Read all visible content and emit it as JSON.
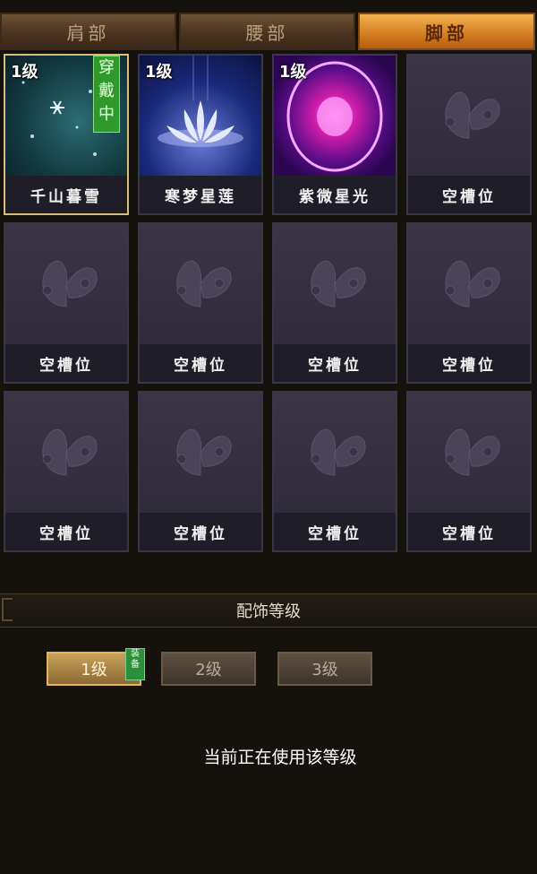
{
  "tabs": [
    "肩部",
    "腰部",
    "脚部"
  ],
  "active_tab": "脚部",
  "slots": [
    {
      "level": "1级",
      "name": "千山暮雪",
      "worn": "穿戴中"
    },
    {
      "level": "1级",
      "name": "寒梦星莲"
    },
    {
      "level": "1级",
      "name": "紫微星光"
    },
    {
      "name": "空槽位"
    },
    {
      "name": "空槽位"
    },
    {
      "name": "空槽位"
    },
    {
      "name": "空槽位"
    },
    {
      "name": "空槽位"
    },
    {
      "name": "空槽位"
    },
    {
      "name": "空槽位"
    },
    {
      "name": "空槽位"
    },
    {
      "name": "空槽位"
    }
  ],
  "section_title": "配饰等级",
  "levels": [
    {
      "label": "1级",
      "tag": "装备"
    },
    {
      "label": "2级"
    },
    {
      "label": "3级"
    }
  ],
  "status_text": "当前正在使用该等级",
  "icons": {
    "empty_slot": "butterfly-icon",
    "slot1": "snowflake-icon",
    "slot2": "lotus-icon",
    "slot3": "purple-orb-icon"
  }
}
